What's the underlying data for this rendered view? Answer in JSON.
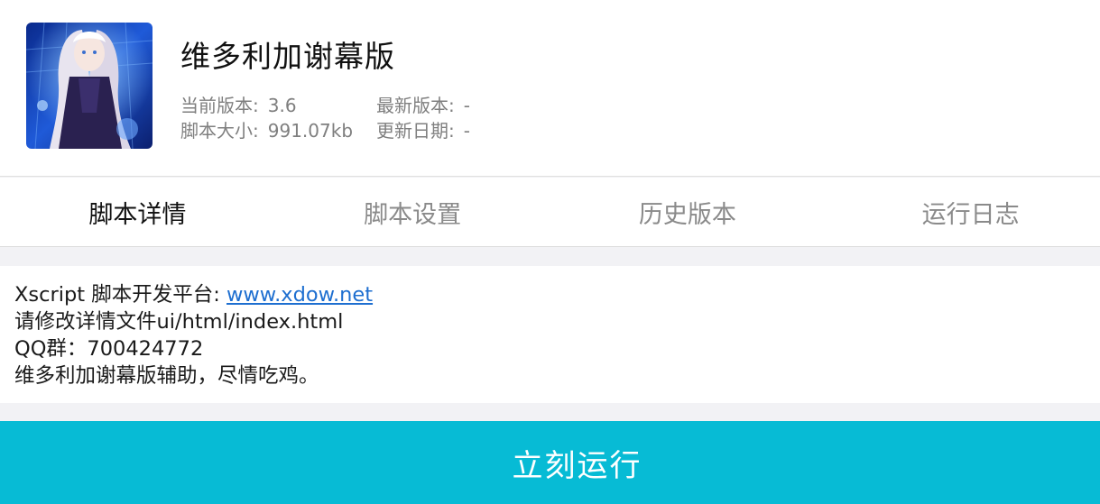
{
  "header": {
    "title": "维多利加谢幕版",
    "current_version_label": "当前版本:",
    "current_version": "3.6",
    "latest_version_label": "最新版本:",
    "latest_version": "-",
    "script_size_label": "脚本大小:",
    "script_size": "991.07kb",
    "update_date_label": "更新日期:",
    "update_date": "-",
    "icon": "anime-girl-avatar"
  },
  "tabs": [
    {
      "label": "脚本详情",
      "active": true
    },
    {
      "label": "脚本设置",
      "active": false
    },
    {
      "label": "历史版本",
      "active": false
    },
    {
      "label": "运行日志",
      "active": false
    }
  ],
  "content": {
    "line1_prefix": "Xscript 脚本开发平台: ",
    "line1_link": "www.xdow.net",
    "line2": "请修改详情文件ui/html/index.html",
    "line3": "QQ群：700424772",
    "line4": "维多利加谢幕版辅助，尽情吃鸡。"
  },
  "run_button": {
    "label": "立刻运行"
  },
  "colors": {
    "accent": "#07bbd5",
    "link": "#1e6fd0"
  }
}
